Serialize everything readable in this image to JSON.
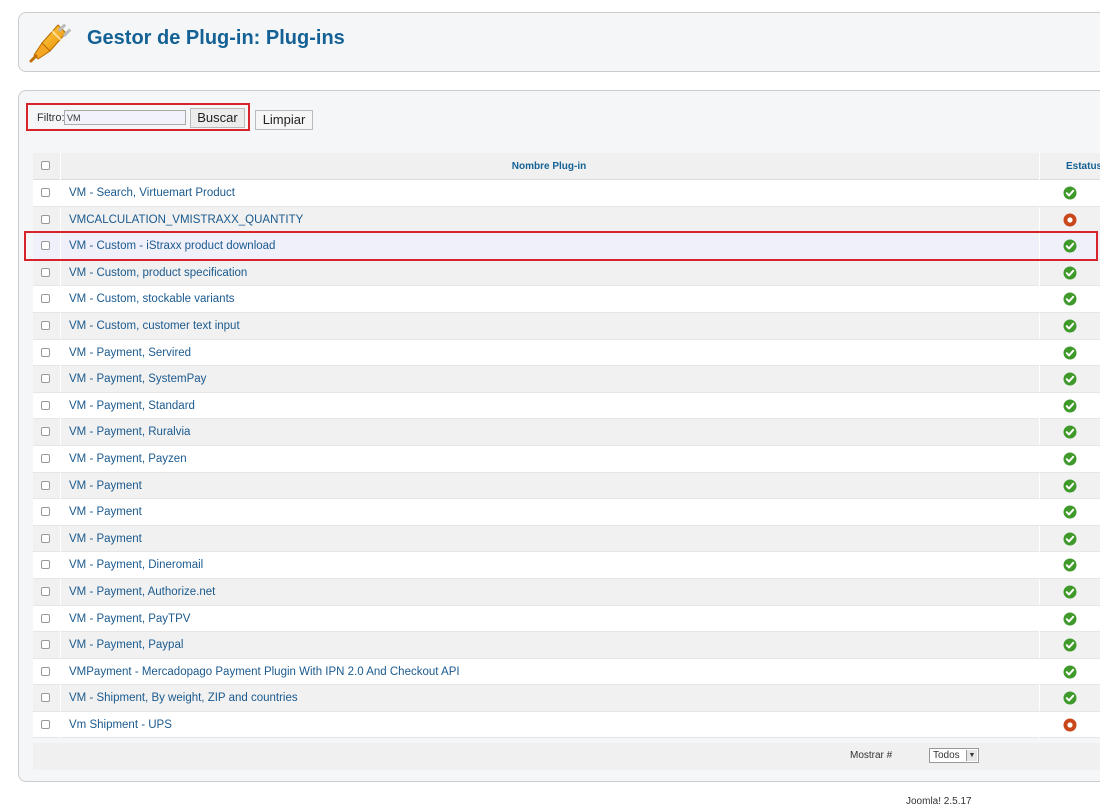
{
  "header": {
    "title": "Gestor de Plug-in: Plug-ins",
    "icon": "plugin-icon"
  },
  "filter": {
    "label": "Filtro:",
    "value": "VM",
    "search_button": "Buscar",
    "clear_button": "Limpiar"
  },
  "table": {
    "col_name": "Nombre Plug-in",
    "col_status": "Estatus",
    "rows": [
      {
        "name": "VM - Search, Virtuemart Product",
        "status": "enabled"
      },
      {
        "name": "VMCALCULATION_VMISTRAXX_QUANTITY",
        "status": "disabled"
      },
      {
        "name": "VM - Custom - iStraxx product download",
        "status": "enabled"
      },
      {
        "name": "VM - Custom, product specification",
        "status": "enabled"
      },
      {
        "name": "VM - Custom, stockable variants",
        "status": "enabled"
      },
      {
        "name": "VM - Custom, customer text input",
        "status": "enabled"
      },
      {
        "name": "VM - Payment, Servired",
        "status": "enabled"
      },
      {
        "name": "VM - Payment, SystemPay",
        "status": "enabled"
      },
      {
        "name": "VM - Payment, Standard",
        "status": "enabled"
      },
      {
        "name": "VM - Payment, Ruralvia",
        "status": "enabled"
      },
      {
        "name": "VM - Payment, Payzen",
        "status": "enabled"
      },
      {
        "name": "VM - Payment",
        "status": "enabled"
      },
      {
        "name": "VM - Payment",
        "status": "enabled"
      },
      {
        "name": "VM - Payment",
        "status": "enabled"
      },
      {
        "name": "VM - Payment, Dineromail",
        "status": "enabled"
      },
      {
        "name": "VM - Payment, Authorize.net",
        "status": "enabled"
      },
      {
        "name": "VM - Payment, PayTPV",
        "status": "enabled"
      },
      {
        "name": "VM - Payment, Paypal",
        "status": "enabled"
      },
      {
        "name": "VMPayment - Mercadopago Payment Plugin With IPN 2.0 And Checkout API",
        "status": "enabled"
      },
      {
        "name": "VM - Shipment, By weight, ZIP and countries",
        "status": "enabled"
      },
      {
        "name": "Vm Shipment - UPS",
        "status": "disabled"
      }
    ]
  },
  "pager": {
    "label": "Mostrar #",
    "selected": "Todos"
  },
  "footer": {
    "version": "Joomla! 2.5.17"
  },
  "colors": {
    "title": "#146295",
    "link": "#1b5a8e",
    "enabled": "#3f9a2b",
    "disabled": "#c8471b",
    "highlight_border": "#d9232a"
  }
}
